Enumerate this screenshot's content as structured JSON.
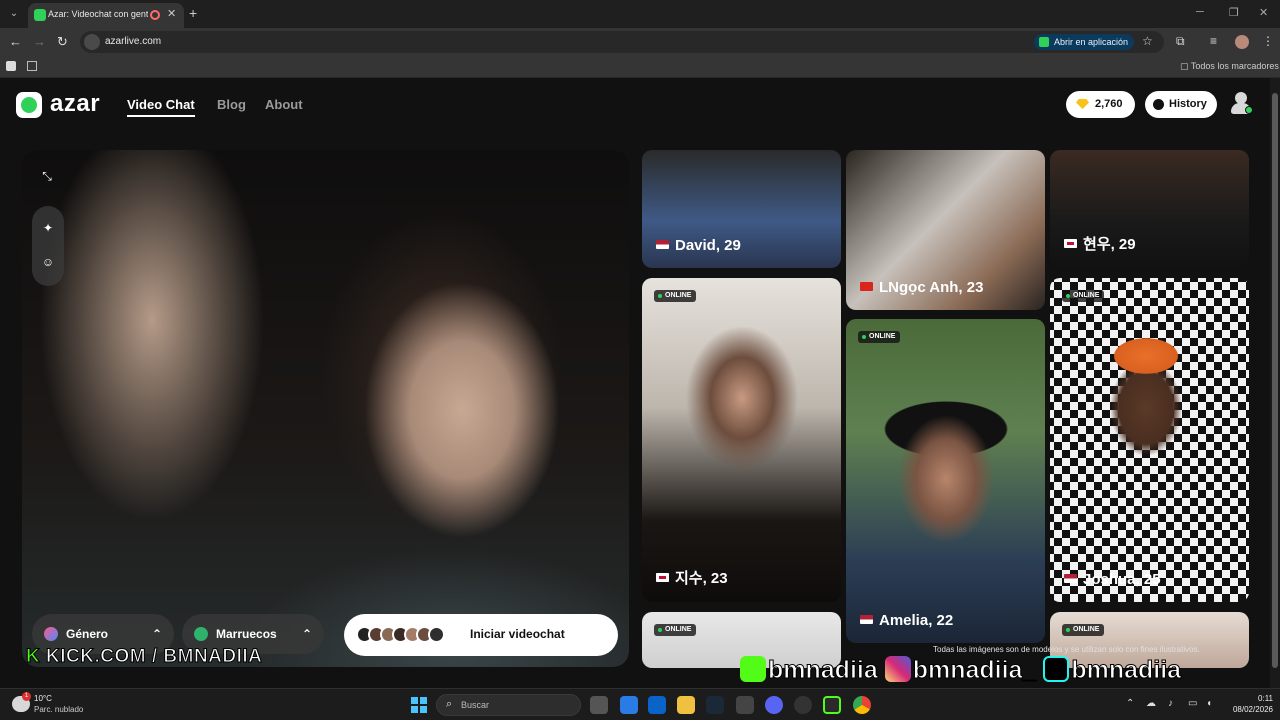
{
  "browser": {
    "tab_title": "Azar: Videochat con gente",
    "url": "azarlive.com",
    "open_in_app": "Abrir en aplicación",
    "all_bookmarks": "Todos los marcadores"
  },
  "site": {
    "logo": "azar",
    "nav": [
      "Video Chat",
      "Blog",
      "About"
    ],
    "gems": "2,760",
    "history": "History"
  },
  "video": {
    "gender_filter": "Género",
    "country_filter": "Marruecos",
    "start_button": "Iniciar videochat",
    "stream_caption": "KICK.COM / BMNADIIA",
    "stream_caption_k": "K"
  },
  "profiles": [
    {
      "name": "David, 29",
      "flag": "us",
      "online": false
    },
    {
      "name": "LNgọc Anh, 23",
      "flag": "vn",
      "online": false
    },
    {
      "name": "현우, 29",
      "flag": "kr",
      "online": false
    },
    {
      "name": "지수, 23",
      "flag": "kr",
      "online": true
    },
    {
      "name": "Amelia, 22",
      "flag": "us",
      "online": true
    },
    {
      "name": "Joshua, 25",
      "flag": "us",
      "online": true
    },
    {
      "name": "",
      "flag": "",
      "online": true
    },
    {
      "name": "",
      "flag": "",
      "online": true
    }
  ],
  "online_label": "ONLINE",
  "disclaimer": "Todas las imágenes son de modelos y se utilizan solo con fines ilustrativos.",
  "social_overlay": {
    "kick": "bmnadiia",
    "instagram": "bmnadiia_",
    "tiktok": "bmnadiia"
  },
  "taskbar": {
    "weather_temp": "10°C",
    "weather_desc": "Parc. nublado",
    "weather_badge": "1",
    "search_placeholder": "Buscar",
    "time": "0:11",
    "date": "08/02/2026"
  },
  "colors": {
    "accent_green": "#30d158",
    "gem_gold": "#f7c31a",
    "kick_green": "#53fc18"
  }
}
